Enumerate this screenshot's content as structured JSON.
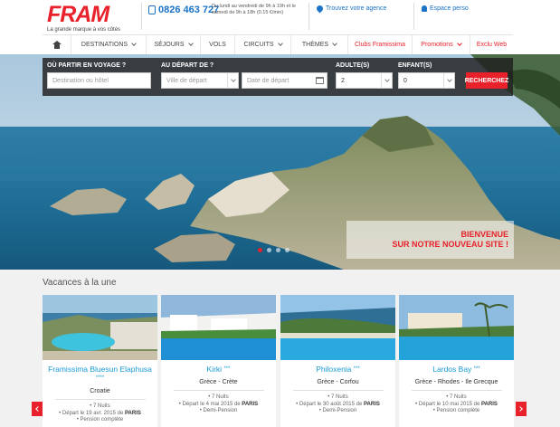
{
  "brand": {
    "logo": "FRAM",
    "tagline": "La grande marque à vos côtés"
  },
  "contact": {
    "phone": "0826 463 727",
    "hours": "Du lundi au vendredi de 9h à 19h et le samedi de 9h à 18h (0.15 €/min)",
    "agency": "Trouvez votre agence",
    "account": "Espace perso"
  },
  "nav": {
    "items": [
      {
        "label": "Destinations"
      },
      {
        "label": "Séjours"
      },
      {
        "label": "Vols"
      },
      {
        "label": "Circuits"
      },
      {
        "label": "Thèmes"
      },
      {
        "label": "Clubs Framissima"
      },
      {
        "label": "Promotions"
      },
      {
        "label": "Exclu Web"
      }
    ]
  },
  "search": {
    "where_label": "OÙ PARTIR EN VOYAGE ?",
    "where_placeholder": "Destination ou hôtel",
    "from_label": "AU DÉPART DE ?",
    "city_placeholder": "Ville de départ",
    "date_placeholder": "Date de départ",
    "adults_label": "ADULTE(S)",
    "adults_value": "2",
    "children_label": "ENFANT(S)",
    "children_value": "0",
    "button": "RECHERCHEZ"
  },
  "hero": {
    "welcome_line1": "BIENVENUE",
    "welcome_line2": "SUR NOTRE NOUVEAU SITE !",
    "slides_count": 4,
    "active_slide": 1
  },
  "section": {
    "title": "Vacances à la une",
    "cards": [
      {
        "name": "Framissima Bluesun Elaphusa",
        "stars": "****",
        "place": "Croatie",
        "nights": "7 Nuits",
        "departure": "Départ le 19 avr. 2015 de",
        "city": "PARIS",
        "board": "Pension complète"
      },
      {
        "name": "Kirki",
        "stars": "***",
        "place": "Grèce - Crète",
        "nights": "7 Nuits",
        "departure": "Départ le 4 mai 2015 de",
        "city": "PARIS",
        "board": "Demi-Pension"
      },
      {
        "name": "Philoxenia",
        "stars": "***",
        "place": "Grèce - Corfou",
        "nights": "7 Nuits",
        "departure": "Départ le 30 août 2015 de",
        "city": "PARIS",
        "board": "Demi-Pension"
      },
      {
        "name": "Lardos Bay",
        "stars": "***",
        "place": "Grèce - Rhodes - Ile Grecque",
        "nights": "7 Nuits",
        "departure": "Départ le 10 mai 2015 de",
        "city": "PARIS",
        "board": "Pension complète"
      }
    ]
  },
  "colors": {
    "accent": "#e8212b",
    "link": "#1a73c7",
    "title_blue": "#1a9ad6"
  }
}
